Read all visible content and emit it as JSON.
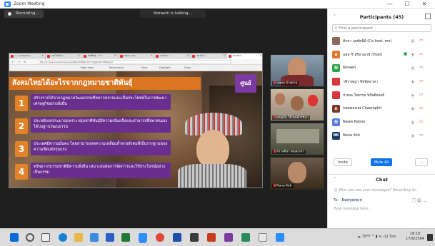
{
  "window": {
    "title": "Zoom Meeting",
    "minimize": "—",
    "maximize": "☐",
    "close": "✕"
  },
  "meeting": {
    "recording_label": "Recording...",
    "talking_label": "Noraerii is talking..."
  },
  "browser": {
    "tabs": [
      "1 - mediantian",
      "กรนไทยไม่ร...",
      "ชาติพันธุ์ - ภา...",
      "Ethnic dev...",
      "สถาบันว...",
      "สถาบันว...",
      "สถาบันว..."
    ],
    "address": "file:///C:/Users/nsa/Downloads/สังคมไทยได้อะไรจากกฎหมายชาติพันธุ์.pdf",
    "page_view": "Page view",
    "read_aloud": "Read aloud",
    "view": "View",
    "highlight": "Highlight",
    "draw": "Draw"
  },
  "slide": {
    "title": "สังคมไทยได้อะไรจากกฎหมายชาติพันธุ์",
    "logo": "ศูนย์",
    "items": [
      {
        "num": "1",
        "text": "สร้างรายได้จากกฎหมายวัฒนธรรมที่หลากหลายและเป็นประโยชน์ในการพัฒนาเศรษฐกิจอย่างยั่งยืน"
      },
      {
        "num": "2",
        "text": "ประหยัดงบประมาณเพราะกลุ่มชาติพันธุ์มีความเข้มแข็งและสามารถพึ่งพาตนเองได้บนฐานวัฒนธรรม"
      },
      {
        "num": "3",
        "text": "ประเทศมีความมั่นคง โดยสามารถลดความเหลื่อมล้ำทางสังคมที่เป็นรากฐานของความขัดแย้งรุนแรง"
      },
      {
        "num": "4",
        "text": "ทรัพยากรธรรมชาติมีความยั่งยืน เหมาะสมต่อการจัดการและใช้ประโยชน์อย่างเป็นธรรม"
      }
    ]
  },
  "videos": [
    {
      "name": "นพดล อ้ายหาย"
    },
    {
      "name": "ผจญภัย วิจักษณ์กรชนา"
    },
    {
      "name": "สว่างค์ษา ทองมาลา"
    },
    {
      "name": "Nana Koh"
    }
  ],
  "participants": {
    "title": "Participants (45)",
    "search_placeholder": "Find a participant",
    "list": [
      {
        "initial": "",
        "name": "ศักดา จุลทัศนีย์ (Co-host, me)",
        "color": "#8a6a5a"
      },
      {
        "initial": "a",
        "name": "มลอารี สุริยาณาธิ (Host)",
        "color": "#e2762a"
      },
      {
        "initial": "N",
        "name": "Noraeri",
        "color": "#2ea44f"
      },
      {
        "initial": "",
        "name": "วชิราพญา ชัชนิตธาดา",
        "color": "#d9363e"
      },
      {
        "initial": "",
        "name": "ปาษณ ใยยรรม ทรัพย์ทองธ์",
        "color": "#d9363e"
      },
      {
        "initial": "n",
        "name": "naowarrat Chaemphit",
        "color": "#7a3a2a"
      },
      {
        "initial": "N",
        "name": "Nawa Kaboo",
        "color": "#5a7de0"
      },
      {
        "initial": "NK",
        "name": "Nana Koh",
        "color": "#1a3a6a"
      }
    ],
    "invite": "Invite",
    "mute_all": "Mute All",
    "more": "..."
  },
  "chat": {
    "title": "Chat",
    "note": "Who can see your messages? Recording On",
    "to_label": "To:",
    "to_value": "Everyone ▾",
    "placeholder": "Type message here..."
  },
  "taskbar": {
    "weather": "79°F",
    "language": "ไทย",
    "time": "18:18",
    "date": "17/8/2564"
  }
}
